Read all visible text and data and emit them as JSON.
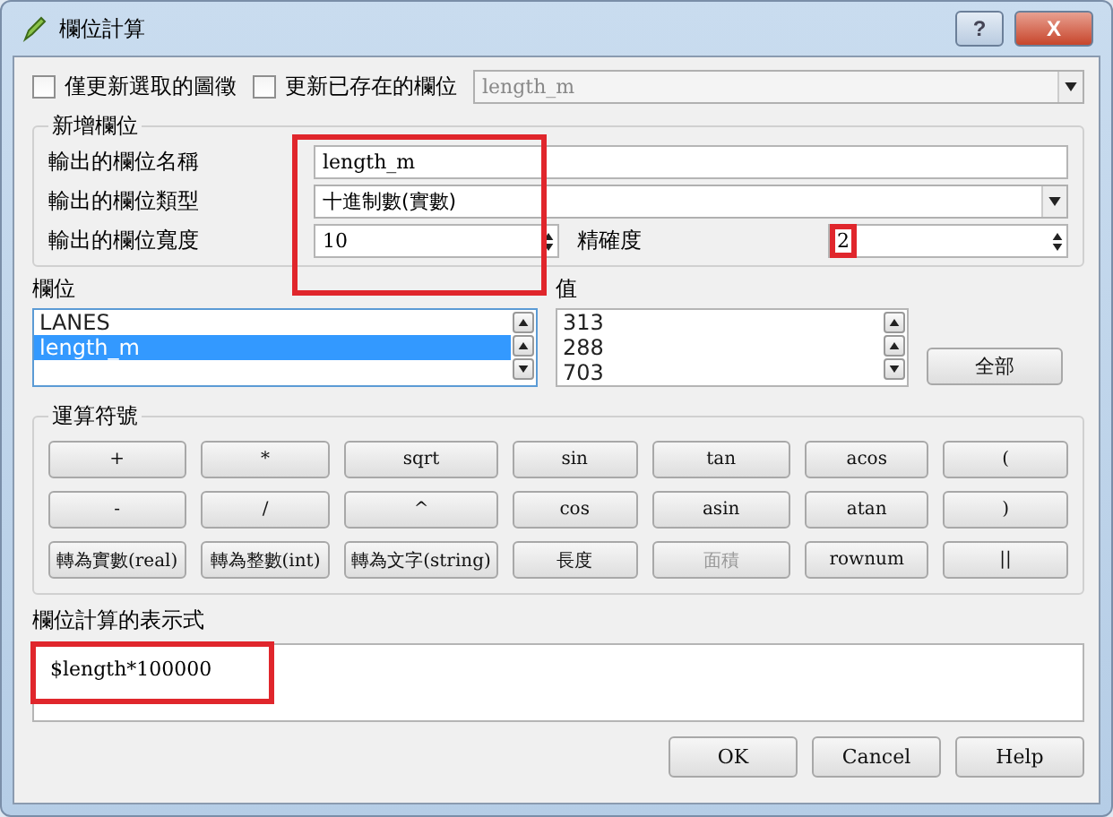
{
  "window": {
    "title": "欄位計算",
    "help_glyph": "?",
    "close_glyph": "X"
  },
  "top": {
    "checkboxes": [
      {
        "label": "僅更新選取的圖徵",
        "checked": false
      },
      {
        "label": "更新已存在的欄位",
        "checked": false
      }
    ],
    "existing_field": {
      "value": "length_m",
      "disabled": true
    }
  },
  "new_field": {
    "title": "新增欄位",
    "highlighted": true,
    "name_label": "輸出的欄位名稱",
    "name_value": "length_m",
    "type_label": "輸出的欄位類型",
    "type_value": "十進制數(實數)",
    "width_label": "輸出的欄位寬度",
    "width_value": "10",
    "precision_label": "精確度",
    "precision_value": "2",
    "precision_highlighted": true
  },
  "fields": {
    "label": "欄位",
    "items": [
      {
        "label": "LANES",
        "selected": false
      },
      {
        "label": "length_m",
        "selected": true
      }
    ]
  },
  "values": {
    "label": "值",
    "items": [
      "313",
      "288",
      "703"
    ],
    "all_button": "全部"
  },
  "operators": {
    "title": "運算符號",
    "buttons": [
      {
        "label": "+",
        "disabled": false
      },
      {
        "label": "*",
        "disabled": false
      },
      {
        "label": "sqrt",
        "disabled": false
      },
      {
        "label": "sin",
        "disabled": false
      },
      {
        "label": "tan",
        "disabled": false
      },
      {
        "label": "acos",
        "disabled": false
      },
      {
        "label": "(",
        "disabled": false
      },
      {
        "label": "-",
        "disabled": false
      },
      {
        "label": "/",
        "disabled": false
      },
      {
        "label": "^",
        "disabled": false
      },
      {
        "label": "cos",
        "disabled": false
      },
      {
        "label": "asin",
        "disabled": false
      },
      {
        "label": "atan",
        "disabled": false
      },
      {
        "label": ")",
        "disabled": false
      },
      {
        "label": "轉為實數(real)",
        "disabled": false
      },
      {
        "label": "轉為整數(int)",
        "disabled": false
      },
      {
        "label": "轉為文字(string)",
        "disabled": false
      },
      {
        "label": "長度",
        "disabled": false
      },
      {
        "label": "面積",
        "disabled": true
      },
      {
        "label": "rownum",
        "disabled": false
      },
      {
        "label": "||",
        "disabled": false
      }
    ]
  },
  "expression": {
    "label": "欄位計算的表示式",
    "value": "$length*100000",
    "highlighted": true
  },
  "buttons": [
    "OK",
    "Cancel",
    "Help"
  ]
}
